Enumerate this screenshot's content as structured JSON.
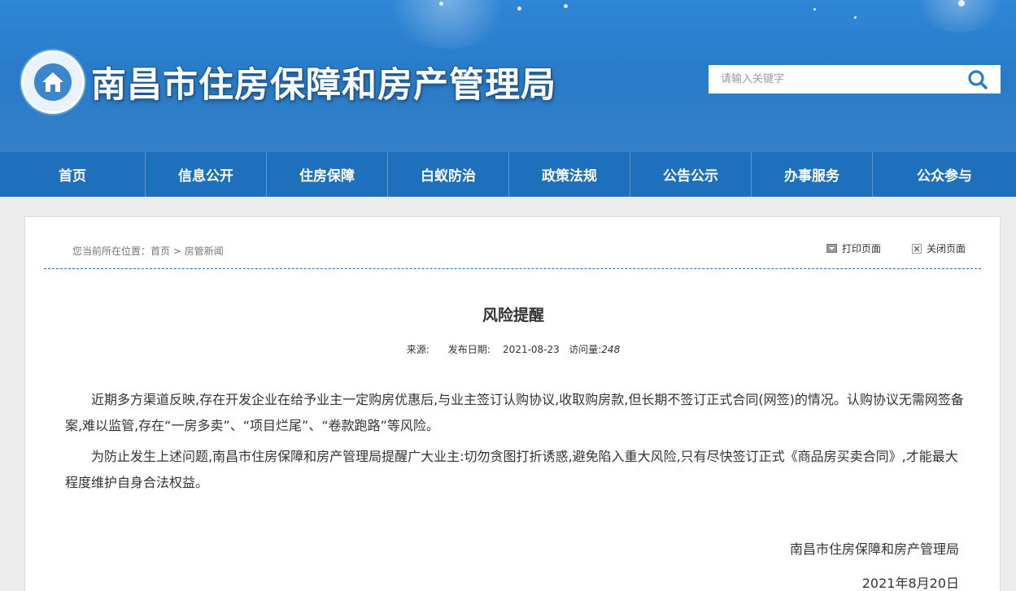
{
  "header": {
    "site_title": "南昌市住房保障和房产管理局",
    "search_placeholder": "请输入关键字"
  },
  "nav": {
    "items": [
      {
        "label": "首页"
      },
      {
        "label": "信息公开"
      },
      {
        "label": "住房保障"
      },
      {
        "label": "白蚁防治"
      },
      {
        "label": "政策法规"
      },
      {
        "label": "公告公示"
      },
      {
        "label": "办事服务"
      },
      {
        "label": "公众参与"
      }
    ]
  },
  "breadcrumb": {
    "prefix": "您当前所在位置：",
    "home": "首页",
    "separator": " > ",
    "current": "房管新闻"
  },
  "tools": {
    "print_label": "打印页面",
    "close_label": "关闭页面"
  },
  "article": {
    "title": "风险提醒",
    "source_label": "来源:",
    "date_label": "发布日期:",
    "date_value": "2021-08-23",
    "views_label": "访问量:",
    "views_value": "248",
    "paragraphs": [
      "近期多方渠道反映,存在开发企业在给予业主一定购房优惠后,与业主签订认购协议,收取购房款,但长期不签订正式合同(网签)的情况。认购协议无需网签备案,难以监管,存在“一房多卖”、“项目烂尾”、“卷款跑路”等风险。",
      "为防止发生上述问题,南昌市住房保障和房产管理局提醒广大业主:切勿贪图打折诱惑,避免陷入重大风险,只有尽快签订正式《商品房买卖合同》,才能最大程度维护自身合法权益。"
    ],
    "signature": "南昌市住房保障和房产管理局",
    "signed_date": "2021年8月20日"
  },
  "colors": {
    "banner": "#2a7cc9",
    "nav": "#1e6fbc",
    "divider": "#2b6fb3"
  }
}
